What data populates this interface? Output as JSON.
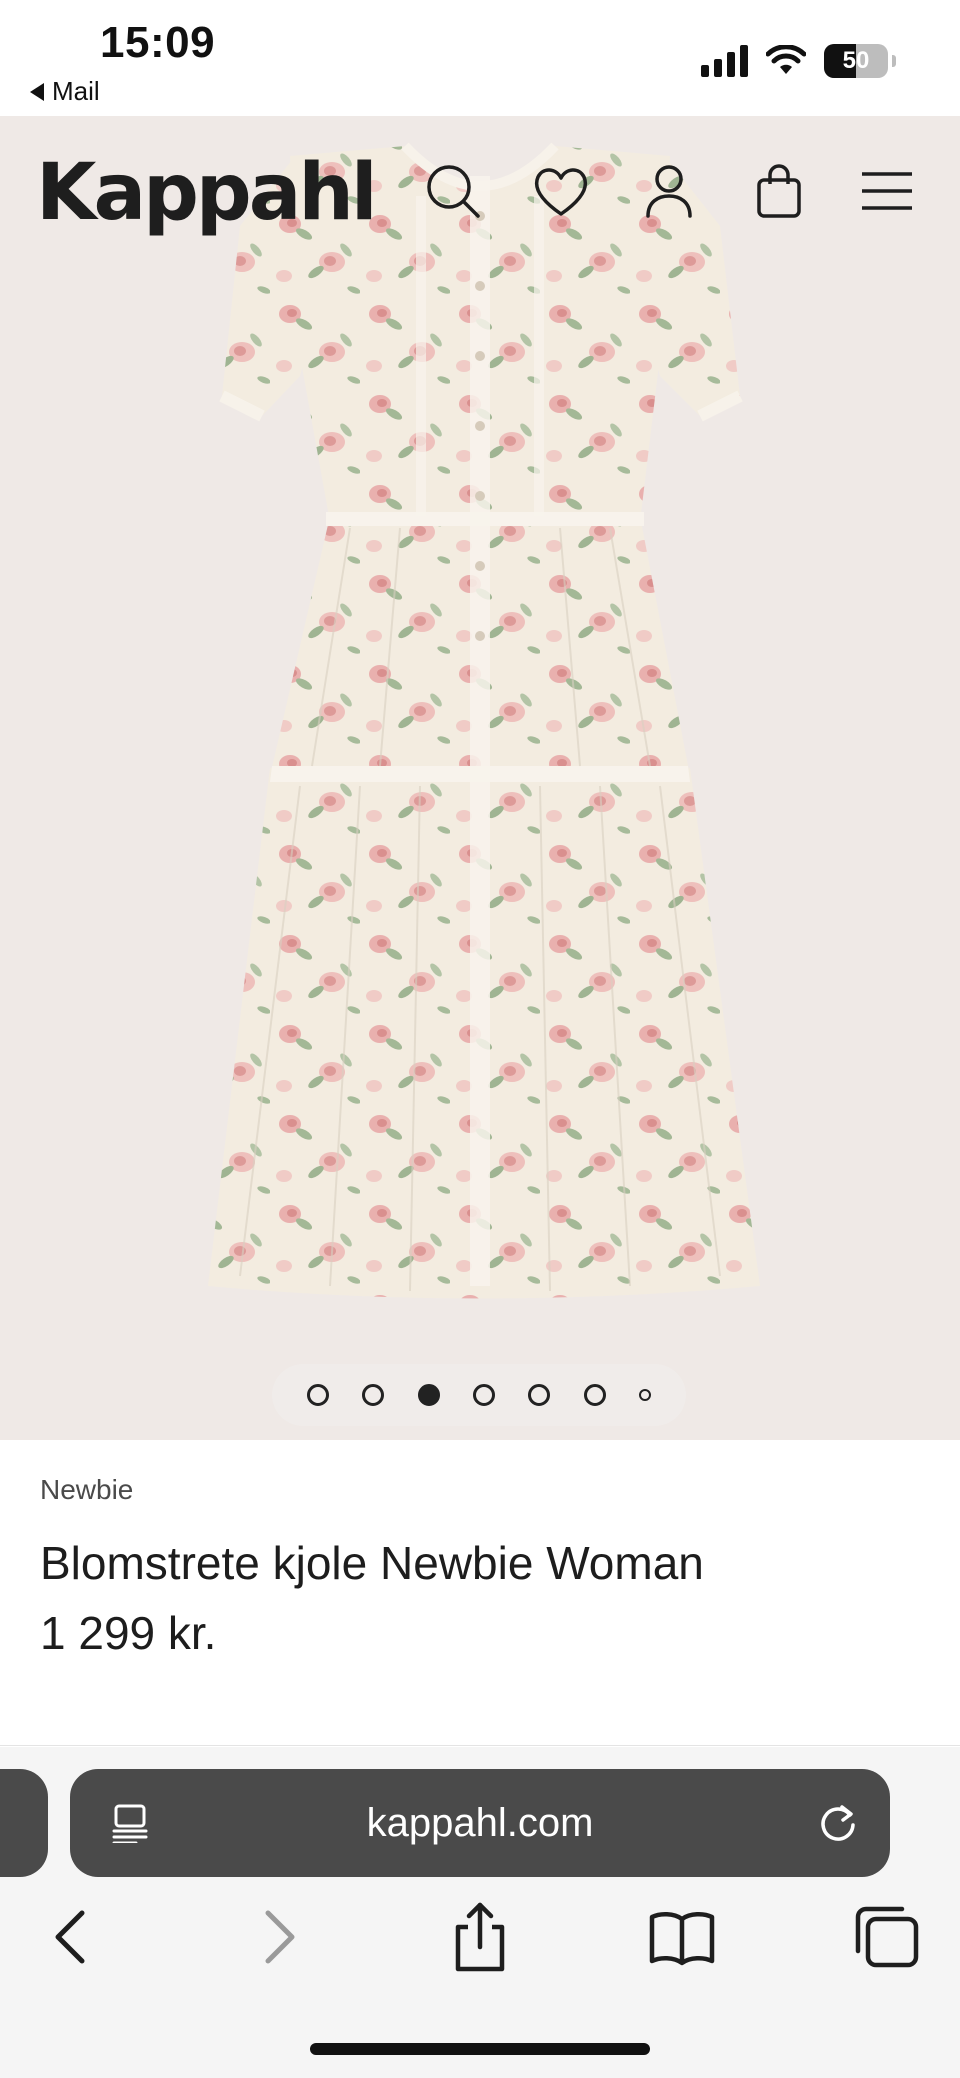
{
  "status_bar": {
    "time": "15:09",
    "back_app_label": "Mail",
    "battery_percent": "50",
    "battery_level": 0.5
  },
  "header": {
    "logo": "Kappahl",
    "icons": [
      "search-icon",
      "heart-icon",
      "account-icon",
      "bag-icon",
      "menu-icon"
    ]
  },
  "gallery": {
    "image_count": 7,
    "active_index": 2,
    "background_color": "#efe9e6"
  },
  "product": {
    "brand": "Newbie",
    "title": "Blomstrete kjole Newbie Woman",
    "price": "1 299 kr."
  },
  "browser": {
    "url": "kappahl.com",
    "toolbar_icons": [
      "back-icon",
      "forward-icon",
      "share-icon",
      "bookmarks-icon",
      "tabs-icon"
    ]
  },
  "colors": {
    "text": "#1d1d1d",
    "urlbar_bg": "#4a4a4a",
    "dress_cream": "#f3ece0",
    "dress_pink": "#e7a7a7",
    "dress_green": "#9fb492"
  }
}
